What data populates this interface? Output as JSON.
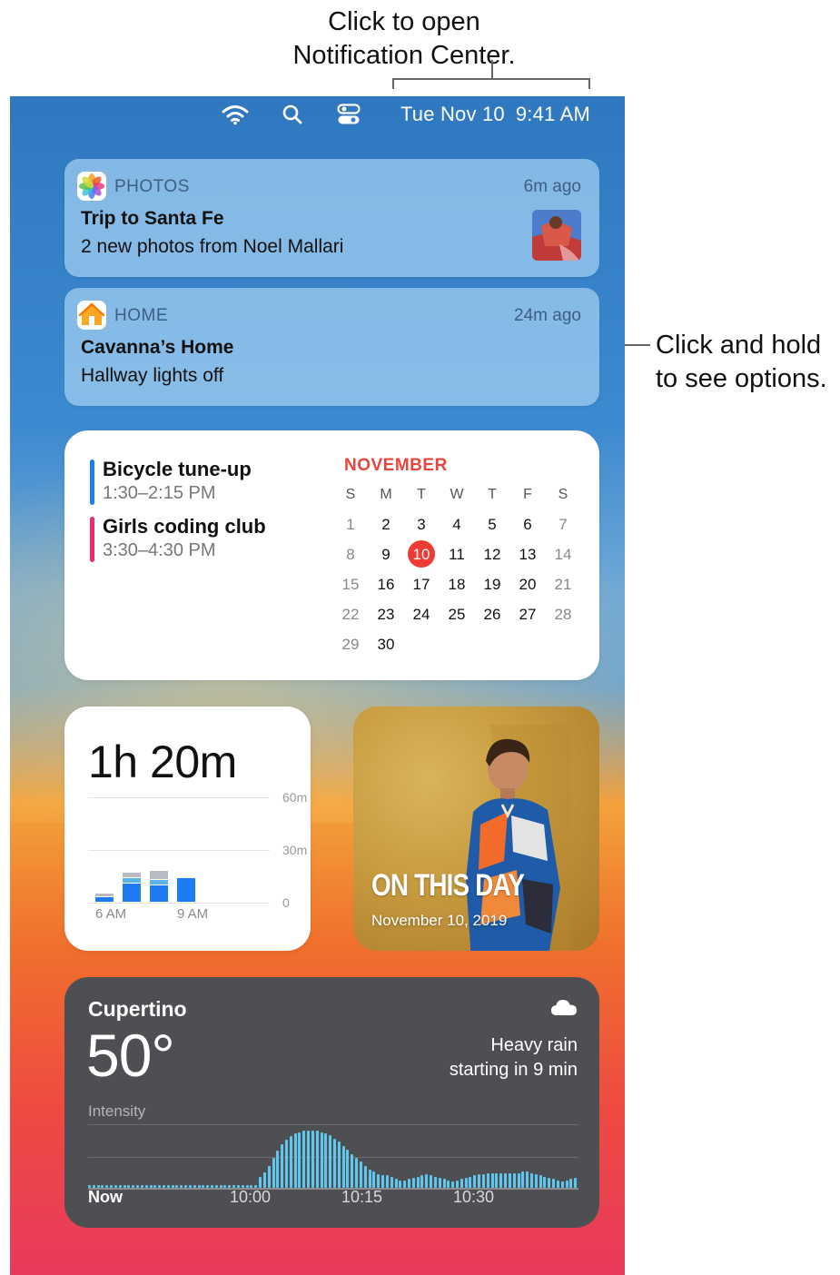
{
  "callouts": {
    "top_line1": "Click to open",
    "top_line2": "Notification Center.",
    "right_line1": "Click and hold",
    "right_line2": "to see options."
  },
  "menubar": {
    "icons": [
      "wifi-icon",
      "search-icon",
      "control-center-icon"
    ],
    "date": "Tue Nov 10",
    "time": "9:41 AM"
  },
  "notifications": [
    {
      "app": "PHOTOS",
      "icon": "photos-app-icon",
      "time": "6m ago",
      "title": "Trip to Santa Fe",
      "body": "2 new photos from Noel Mallari"
    },
    {
      "app": "HOME",
      "icon": "home-app-icon",
      "time": "24m ago",
      "title": "Cavanna’s Home",
      "body": "Hallway lights off"
    }
  ],
  "calendar": {
    "events": [
      {
        "title": "Bicycle tune-up",
        "time": "1:30–2:15 PM",
        "color": "#1e7cf2"
      },
      {
        "title": "Girls coding club",
        "time": "3:30–4:30 PM",
        "color": "#ee2a6b"
      }
    ],
    "month": "NOVEMBER",
    "weekdays": [
      "S",
      "M",
      "T",
      "W",
      "T",
      "F",
      "S"
    ],
    "weeks": [
      [
        "1",
        "2",
        "3",
        "4",
        "5",
        "6",
        "7"
      ],
      [
        "8",
        "9",
        "10",
        "11",
        "12",
        "13",
        "14"
      ],
      [
        "15",
        "16",
        "17",
        "18",
        "19",
        "20",
        "21"
      ],
      [
        "22",
        "23",
        "24",
        "25",
        "26",
        "27",
        "28"
      ],
      [
        "29",
        "30",
        "",
        "",
        "",
        "",
        ""
      ]
    ],
    "today": "10",
    "today_color": "#ee3b34"
  },
  "screen_time": {
    "total": "1h 20m",
    "ticks": [
      "60m",
      "30m",
      "0"
    ],
    "x_labels": [
      "6 AM",
      "9 AM"
    ],
    "chart_data": {
      "type": "bar",
      "categories": [
        "6 AM",
        "7 AM",
        "8 AM",
        "9 AM"
      ],
      "series": [
        {
          "values": [
            3,
            11,
            10,
            14
          ],
          "color": "#1e7cf2"
        },
        {
          "values": [
            0,
            3,
            3,
            0
          ],
          "color": "#5ab4f0"
        },
        {
          "values": [
            2,
            3,
            5,
            0
          ],
          "color": "#b8bcc2"
        }
      ],
      "ylim": [
        0,
        60
      ]
    }
  },
  "photo_widget": {
    "title": "ON THIS DAY",
    "date": "November 10, 2019"
  },
  "weather": {
    "city": "Cupertino",
    "temperature": "50°",
    "condition_line1": "Heavy rain",
    "condition_line2": "starting in 9 min",
    "intensity_label": "Intensity",
    "icon": "cloud-icon",
    "x_labels": [
      "Now",
      "10:00",
      "10:15",
      "10:30"
    ],
    "chart_data": {
      "type": "bar",
      "values": [
        0.05,
        0.05,
        0.05,
        0.05,
        0.05,
        0.05,
        0.05,
        0.05,
        0.05,
        0.05,
        0.05,
        0.05,
        0.05,
        0.05,
        0.05,
        0.05,
        0.05,
        0.05,
        0.05,
        0.05,
        0.05,
        0.05,
        0.05,
        0.05,
        0.05,
        0.05,
        0.05,
        0.05,
        0.05,
        0.05,
        0.05,
        0.05,
        0.05,
        0.05,
        0.05,
        0.05,
        0.05,
        0.05,
        0.05,
        0.18,
        0.25,
        0.35,
        0.48,
        0.6,
        0.7,
        0.78,
        0.84,
        0.88,
        0.9,
        0.92,
        0.93,
        0.93,
        0.92,
        0.9,
        0.88,
        0.85,
        0.8,
        0.75,
        0.68,
        0.62,
        0.55,
        0.48,
        0.42,
        0.36,
        0.3,
        0.26,
        0.22,
        0.2,
        0.2,
        0.18,
        0.14,
        0.12,
        0.12,
        0.14,
        0.16,
        0.18,
        0.2,
        0.22,
        0.2,
        0.18,
        0.16,
        0.14,
        0.12,
        0.1,
        0.12,
        0.14,
        0.16,
        0.18,
        0.2,
        0.22,
        0.22,
        0.24,
        0.24,
        0.24,
        0.24,
        0.24,
        0.24,
        0.24,
        0.24,
        0.26,
        0.26,
        0.24,
        0.22,
        0.2,
        0.18,
        0.16,
        0.14,
        0.12,
        0.1,
        0.12,
        0.14,
        0.16
      ],
      "ylim": [
        0,
        1
      ],
      "bar_color": "#5fc6ee"
    }
  }
}
